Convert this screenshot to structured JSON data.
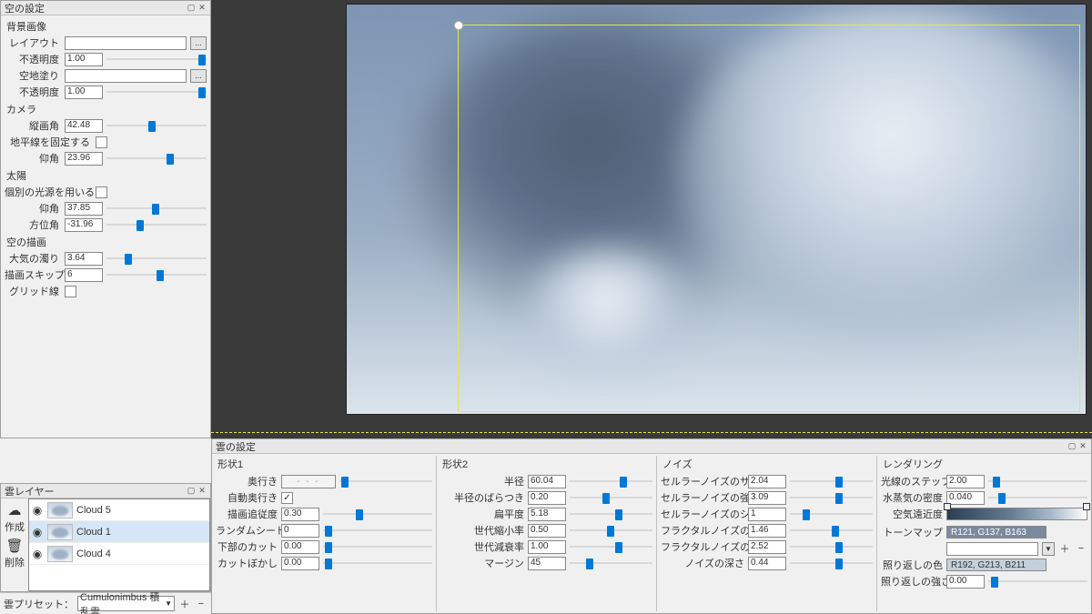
{
  "panels": {
    "sky_title": "空の設定",
    "layers_title": "雲レイヤー",
    "cloud_title": "雲の設定"
  },
  "sky": {
    "bg_image_section": "背景画像",
    "layout_label": "レイアウト",
    "opacity_label": "不透明度",
    "opacity1": "1.00",
    "ground_fill_label": "空地塗り",
    "opacity2": "1.00",
    "camera_section": "カメラ",
    "fov_label": "縦画角",
    "fov": "42.48",
    "lock_horizon_label": "地平線を固定する",
    "lock_horizon": false,
    "elev_label": "仰角",
    "elev": "23.96",
    "sun_section": "太陽",
    "sun_own_light_label": "個別の光源を用いる",
    "sun_own_light": false,
    "sun_elev_label": "仰角",
    "sun_elev": "37.85",
    "sun_azi_label": "方位角",
    "sun_azi": "-31.96",
    "sky_draw_section": "空の描画",
    "turbidity_label": "大気の濁り",
    "turbidity": "3.64",
    "draw_skip_label": "描画スキップ",
    "draw_skip": "6",
    "grid_label": "グリッド線",
    "grid": false
  },
  "layers": {
    "tool_create": "作成",
    "tool_delete": "削除",
    "items": [
      {
        "name": "Cloud 5",
        "visible": true,
        "selected": false
      },
      {
        "name": "Cloud 1",
        "visible": true,
        "selected": true
      },
      {
        "name": "Cloud 4",
        "visible": true,
        "selected": false
      }
    ],
    "preset_label": "雲プリセット：",
    "preset_value": "Cumulonimbus 積乱雲"
  },
  "cloud": {
    "shape1": {
      "title": "形状1",
      "depth_label": "奥行き",
      "depth_disp": "- - -",
      "auto_depth_label": "自動奥行き",
      "auto_depth": true,
      "follow_label": "描画追従度",
      "follow": "0.30",
      "seed_label": "ランダムシード",
      "seed": "0",
      "bottom_cut_label": "下部のカット",
      "bottom_cut": "0.00",
      "cut_blur_label": "カットぼかし",
      "cut_blur": "0.00"
    },
    "shape2": {
      "title": "形状2",
      "radius_label": "半径",
      "radius": "60.04",
      "radius_var_label": "半径のばらつき",
      "radius_var": "0.20",
      "flat_label": "扁平度",
      "flat": "5.18",
      "gen_shrink_label": "世代縮小率",
      "gen_shrink": "0.50",
      "gen_decay_label": "世代減衰率",
      "gen_decay": "1.00",
      "margin_label": "マージン",
      "margin": "45"
    },
    "noise": {
      "title": "ノイズ",
      "cell_size_label": "セルラーノイズのサイズ",
      "cell_size": "2.04",
      "cell_str_label": "セルラーノイズの強度",
      "cell_str": "3.09",
      "cell_seed_label": "セルラーノイズのシード",
      "cell_seed": "1",
      "frac_size_label": "フラクタルノイズのサイズ",
      "frac_size": "1.46",
      "frac_str_label": "フラクタルノイズの強度",
      "frac_str": "2.52",
      "noise_depth_label": "ノイズの深さ",
      "noise_depth": "0.44"
    },
    "render": {
      "title": "レンダリング",
      "ray_step_label": "光線のステップ",
      "ray_step": "2.00",
      "density_label": "水蒸気の密度",
      "density": "0.040",
      "aerial_label": "空気遠近度",
      "tonemap_label": "トーンマップ",
      "tonemap_swatch": "R121, G137, B163",
      "bounce_color_label": "照り返しの色",
      "bounce_swatch": "R192, G213, B211",
      "bounce_str_label": "照り返しの強さ",
      "bounce_str": "0.00"
    }
  }
}
